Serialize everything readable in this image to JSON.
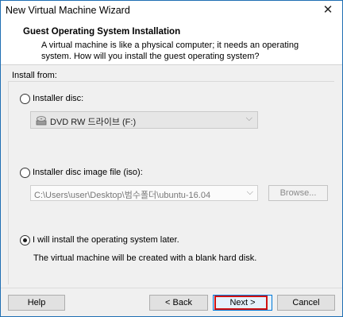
{
  "window": {
    "title": "New Virtual Machine Wizard",
    "close_glyph": "✕"
  },
  "header": {
    "title": "Guest Operating System Installation",
    "description": "A virtual machine is like a physical computer; it needs an operating system. How will you install the guest operating system?"
  },
  "install_from": {
    "label": "Install from:",
    "options": [
      {
        "label": "Installer disc:",
        "selected": false
      },
      {
        "label": "Installer disc image file (iso):",
        "selected": false
      },
      {
        "label": "I will install the operating system later.",
        "selected": true
      }
    ],
    "disc_select": {
      "value": "DVD RW 드라이브 (F:)",
      "icon": "disc-drive-icon"
    },
    "iso_field": {
      "value": "C:\\Users\\user\\Desktop\\범수폴더\\ubuntu-16.04"
    },
    "browse_label": "Browse...",
    "later_note": "The virtual machine will be created with a blank hard disk."
  },
  "footer": {
    "help_label": "Help",
    "back_label": "< Back",
    "next_label": "Next >",
    "cancel_label": "Cancel"
  },
  "colors": {
    "window_border": "#1f6fb3",
    "next_border": "#0078d7",
    "highlight_red": "#d01010"
  }
}
